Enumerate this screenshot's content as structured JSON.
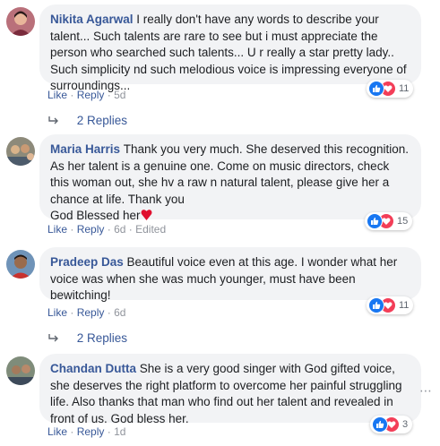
{
  "comments": [
    {
      "author": "Nikita Agarwal",
      "text": "I really don't have any words to describe your talent... Such talents are rare to see but i must appreciate the person who searched such talents... U r really a star pretty lady.. Such simplicity nd such melodious voice is impressing everyone of surroundings...",
      "like": "Like",
      "reply": "Reply",
      "time": "5d",
      "reaction_count": "11",
      "replies": "2 Replies"
    },
    {
      "author": "Maria Harris",
      "text": "Thank you very much. She deserved this recognition. As her talent is a genuine one. Come on music directors, check this woman out, she hv a raw n natural talent, please give her a chance at life. Thank you\nGod Blessed her",
      "like": "Like",
      "reply": "Reply",
      "time": "6d",
      "edited": "Edited",
      "reaction_count": "15"
    },
    {
      "author": "Pradeep Das",
      "text": "Beautiful voice even at this age. I wonder what her voice was when she was much younger, must have been bewitching!",
      "like": "Like",
      "reply": "Reply",
      "time": "6d",
      "reaction_count": "11",
      "replies": "2 Replies"
    },
    {
      "author": "Chandan Dutta",
      "text": "She is a very good singer with God gifted voice, she deserves the right platform to overcome her painful struggling life. Also thanks that man who find out her talent and revealed in front of us. God bless her.",
      "like": "Like",
      "reply": "Reply",
      "time": "1d",
      "reaction_count": "3"
    }
  ],
  "separator": "·",
  "icons": {
    "like": "like-reaction-icon",
    "love": "love-reaction-icon",
    "reply_arrow": "reply-arrow-icon",
    "more": "more-options-icon",
    "heart": "red-heart-emoji"
  },
  "colors": {
    "link": "#385898",
    "bubble": "#f2f3f5",
    "like": "#1877f2",
    "love": "#f33e58"
  }
}
